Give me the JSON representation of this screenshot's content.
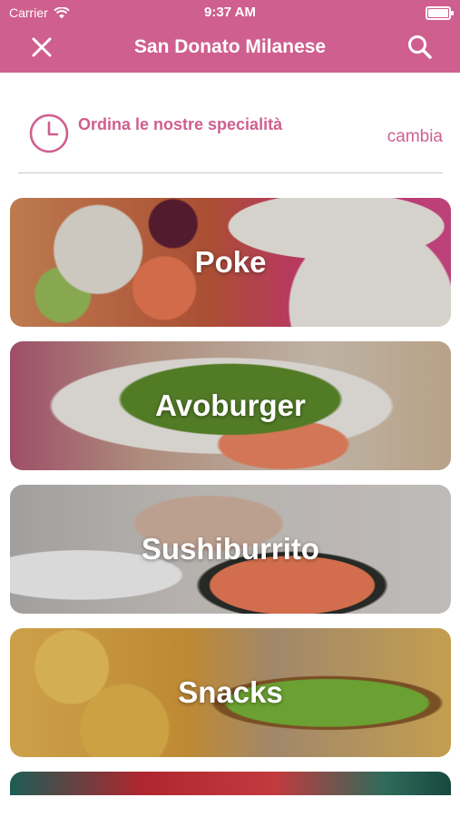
{
  "status_bar": {
    "carrier": "Carrier",
    "time": "9:37 AM"
  },
  "nav": {
    "title": "San Donato Milanese"
  },
  "schedule": {
    "label": "Ordina le nostre specialità",
    "change": "cambia"
  },
  "categories": [
    {
      "label": "Poke"
    },
    {
      "label": "Avoburger"
    },
    {
      "label": "Sushiburrito"
    },
    {
      "label": "Snacks"
    }
  ],
  "colors": {
    "brand": "#cf5f8f"
  },
  "icons": [
    "wifi-icon",
    "battery-icon",
    "close-icon",
    "search-icon",
    "clock-icon"
  ]
}
